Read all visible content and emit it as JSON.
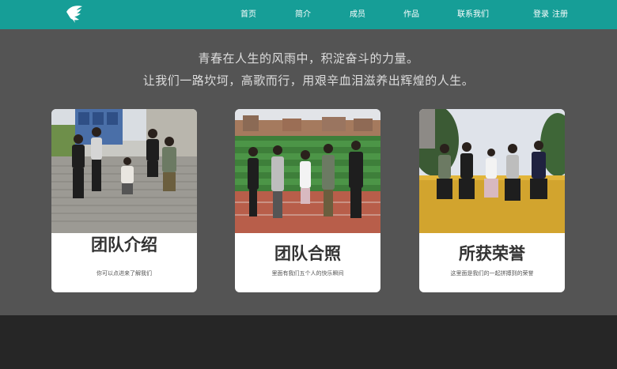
{
  "nav": {
    "logo_icon": "bird-logo-icon",
    "items": [
      "首页",
      "简介",
      "成员",
      "作品",
      "联系我们"
    ],
    "login": "登录",
    "register": "注册"
  },
  "hero": {
    "line1": "青春在人生的风雨中，积淀奋斗的力量。",
    "line2": "让我们一路坎坷，高歌而行，用艰辛血泪滋养出辉煌的人生。"
  },
  "cards": [
    {
      "title": "团队介绍",
      "desc": "你可以点进来了解我们"
    },
    {
      "title": "团队合照",
      "desc": "里面有我们五个人的快乐瞬间"
    },
    {
      "title": "所获荣誉",
      "desc": "这里面是我们的一起拼搏到的荣誉"
    }
  ],
  "colors": {
    "navbar": "#169e97",
    "background": "#545454",
    "footer": "#262626",
    "card": "#ffffff"
  }
}
